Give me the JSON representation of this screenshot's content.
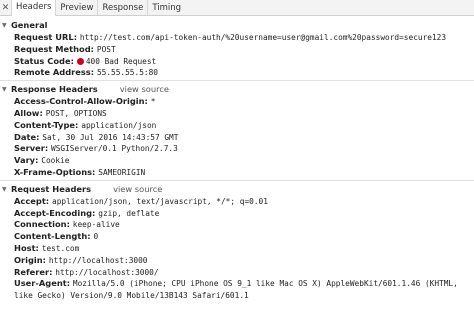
{
  "tabs": [
    {
      "label": "Headers"
    },
    {
      "label": "Preview"
    },
    {
      "label": "Response"
    },
    {
      "label": "Timing"
    }
  ],
  "general": {
    "title": "General",
    "rows": [
      {
        "key": "Request URL:",
        "value": "http://test.com/api-token-auth/%20username=user@gmail.com%20password=secure123"
      },
      {
        "key": "Request Method:",
        "value": "POST"
      },
      {
        "key": "Status Code:",
        "value": "400 Bad Request",
        "status_color": "#d0021b"
      },
      {
        "key": "Remote Address:",
        "value": "55.55.55.5:80"
      }
    ]
  },
  "response_headers": {
    "title": "Response Headers",
    "view_source": "view source",
    "rows": [
      {
        "key": "Access-Control-Allow-Origin:",
        "value": "*"
      },
      {
        "key": "Allow:",
        "value": "POST, OPTIONS"
      },
      {
        "key": "Content-Type:",
        "value": "application/json"
      },
      {
        "key": "Date:",
        "value": "Sat, 30 Jul 2016 14:43:57 GMT"
      },
      {
        "key": "Server:",
        "value": "WSGIServer/0.1 Python/2.7.3"
      },
      {
        "key": "Vary:",
        "value": "Cookie"
      },
      {
        "key": "X-Frame-Options:",
        "value": "SAMEORIGIN"
      }
    ]
  },
  "request_headers": {
    "title": "Request Headers",
    "view_source": "view source",
    "rows": [
      {
        "key": "Accept:",
        "value": "application/json, text/javascript, */*; q=0.01"
      },
      {
        "key": "Accept-Encoding:",
        "value": "gzip, deflate"
      },
      {
        "key": "Connection:",
        "value": "keep-alive"
      },
      {
        "key": "Content-Length:",
        "value": "0"
      },
      {
        "key": "Host:",
        "value": "test.com"
      },
      {
        "key": "Origin:",
        "value": "http://localhost:3000"
      },
      {
        "key": "Referer:",
        "value": "http://localhost:3000/"
      },
      {
        "key": "User-Agent:",
        "value": "Mozilla/5.0 (iPhone; CPU iPhone OS 9_1 like Mac OS X) AppleWebKit/601.1.46 (KHTML, like Gecko) Version/9.0 Mobile/13B143 Safari/601.1"
      }
    ]
  },
  "icons": {
    "close": "close-icon",
    "expand": "triangle-down-icon"
  }
}
